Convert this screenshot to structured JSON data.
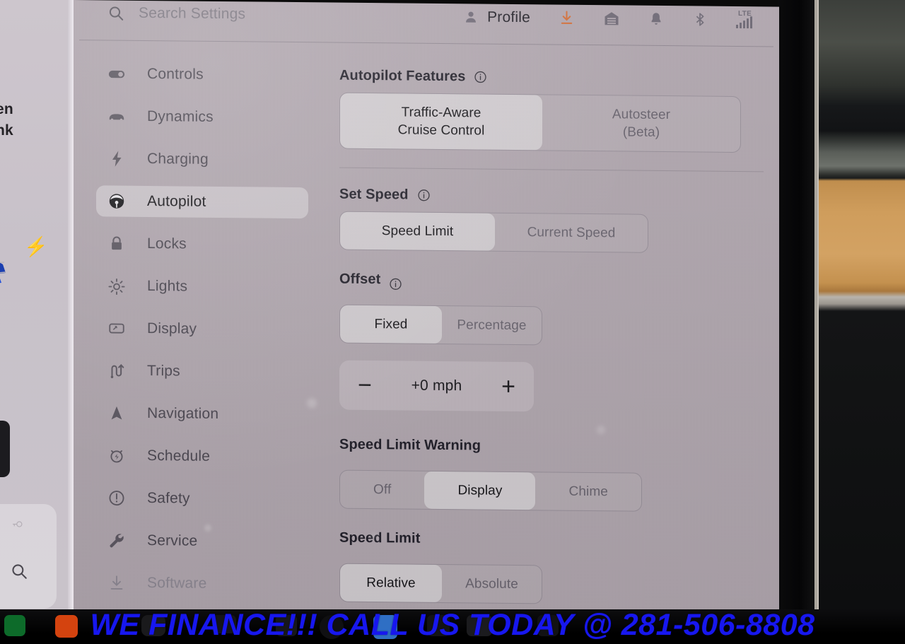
{
  "header": {
    "search_placeholder": "Search Settings",
    "profile_label": "Profile",
    "icons": [
      {
        "name": "person-icon",
        "glyph": "person"
      },
      {
        "name": "download-icon",
        "glyph": "download",
        "color": "#d4703a"
      },
      {
        "name": "garage-icon",
        "glyph": "garage"
      },
      {
        "name": "bell-icon",
        "glyph": "bell"
      },
      {
        "name": "bluetooth-icon",
        "glyph": "bluetooth"
      },
      {
        "name": "lte-signal-icon",
        "glyph": "signal"
      }
    ],
    "lte_label": "LTE"
  },
  "sidebar": {
    "items": [
      {
        "label": "Controls",
        "icon": "toggle-icon",
        "active": false
      },
      {
        "label": "Dynamics",
        "icon": "car-icon",
        "active": false
      },
      {
        "label": "Charging",
        "icon": "bolt-icon",
        "active": false
      },
      {
        "label": "Autopilot",
        "icon": "steering-wheel-icon",
        "active": true
      },
      {
        "label": "Locks",
        "icon": "lock-icon",
        "active": false
      },
      {
        "label": "Lights",
        "icon": "sun-icon",
        "active": false
      },
      {
        "label": "Display",
        "icon": "display-icon",
        "active": false
      },
      {
        "label": "Trips",
        "icon": "trips-icon",
        "active": false
      },
      {
        "label": "Navigation",
        "icon": "navigation-arrow-icon",
        "active": false
      },
      {
        "label": "Schedule",
        "icon": "schedule-clock-icon",
        "active": false
      },
      {
        "label": "Safety",
        "icon": "alert-circle-icon",
        "active": false
      },
      {
        "label": "Service",
        "icon": "wrench-icon",
        "active": false
      },
      {
        "label": "Software",
        "icon": "software-download-icon",
        "active": false,
        "dim": true
      }
    ]
  },
  "main": {
    "autopilot_features": {
      "title": "Autopilot Features",
      "has_info": true,
      "options": [
        {
          "label_line1": "Traffic-Aware",
          "label_line2": "Cruise Control",
          "selected": true
        },
        {
          "label_line1": "Autosteer",
          "label_line2": "(Beta)",
          "selected": false
        }
      ]
    },
    "set_speed": {
      "title": "Set Speed",
      "has_info": true,
      "options": [
        {
          "label": "Speed Limit",
          "selected": true
        },
        {
          "label": "Current Speed",
          "selected": false
        }
      ]
    },
    "offset": {
      "title": "Offset",
      "has_info": true,
      "options": [
        {
          "label": "Fixed",
          "selected": true
        },
        {
          "label": "Percentage",
          "selected": false
        }
      ],
      "stepper": {
        "minus_label": "−",
        "value": "+0 mph",
        "plus_label": "+"
      }
    },
    "speed_limit_warning": {
      "title": "Speed Limit Warning",
      "has_info": false,
      "options": [
        {
          "label": "Off",
          "selected": false
        },
        {
          "label": "Display",
          "selected": true
        },
        {
          "label": "Chime",
          "selected": false
        }
      ]
    },
    "speed_limit": {
      "title": "Speed Limit",
      "has_info": false,
      "options": [
        {
          "label": "Relative",
          "selected": true
        },
        {
          "label": "Absolute",
          "selected": false
        }
      ]
    }
  },
  "left_partial": {
    "text_line1": "en",
    "text_line2": "nk"
  },
  "banner": {
    "text": "WE FINANCE!!! CALL US TODAY @ 281-506-8808",
    "color": "#1717ef"
  },
  "colors": {
    "screen_bg": "#b2a8b0",
    "selected_segment": "rgba(255,255,255,0.40)",
    "text_primary": "#18171b",
    "text_secondary": "#6a6570",
    "accent_orange": "#d4703a"
  }
}
